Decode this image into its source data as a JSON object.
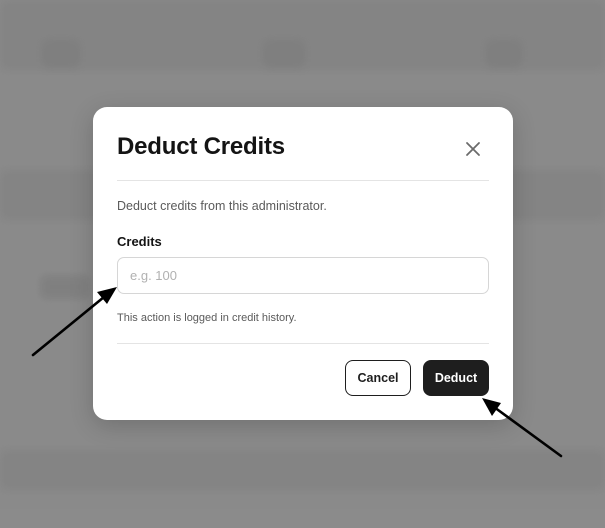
{
  "dialog": {
    "title": "Deduct Credits",
    "description": "Deduct credits from this administrator.",
    "field_label": "Credits",
    "input_value": "",
    "input_placeholder": "e.g. 100",
    "hint": "This action is logged in credit history.",
    "cancel_label": "Cancel",
    "deduct_label": "Deduct",
    "close_icon": "close-icon"
  },
  "colors": {
    "primary_button": "#1e1e1e",
    "backdrop": "#8e8e8e",
    "annotation_arrow": "#000000"
  }
}
